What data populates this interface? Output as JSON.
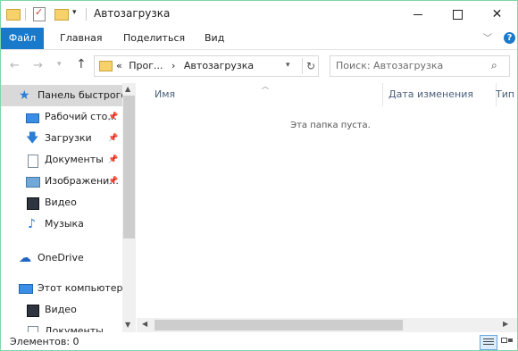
{
  "window": {
    "title": "Автозагрузка"
  },
  "ribbon": {
    "tabs": [
      "Файл",
      "Главная",
      "Поделиться",
      "Вид"
    ],
    "help": "?"
  },
  "address": {
    "prefix": "«",
    "segments": [
      "Прог...",
      "Автозагрузка"
    ]
  },
  "search": {
    "placeholder": "Поиск: Автозагрузка"
  },
  "nav_pane": {
    "items": [
      {
        "label": "Панель быстрого доступа",
        "icon": "star-icon",
        "pinned": false,
        "selected": true
      },
      {
        "label": "Рабочий сто...",
        "icon": "desktop-icon",
        "pinned": true
      },
      {
        "label": "Загрузки",
        "icon": "download-icon",
        "pinned": true
      },
      {
        "label": "Документы",
        "icon": "documents-icon",
        "pinned": true
      },
      {
        "label": "Изображени...",
        "icon": "pictures-icon",
        "pinned": true
      },
      {
        "label": "Видео",
        "icon": "video-icon",
        "pinned": false
      },
      {
        "label": "Музыка",
        "icon": "music-icon",
        "pinned": false
      },
      {
        "label": "OneDrive",
        "icon": "onedrive-icon",
        "pinned": false
      },
      {
        "label": "Этот компьютер",
        "icon": "computer-icon",
        "pinned": false
      },
      {
        "label": "Видео",
        "icon": "video-icon",
        "pinned": false
      },
      {
        "label": "Документы",
        "icon": "documents-icon",
        "pinned": false
      }
    ]
  },
  "columns": {
    "name": "Имя",
    "date": "Дата изменения",
    "type": "Тип"
  },
  "content": {
    "empty_message": "Эта папка пуста."
  },
  "status": {
    "items_count": "Элементов: 0"
  },
  "colors": {
    "accent": "#1979ca",
    "selected": "#d9d9d9",
    "frame": "#7ed6a8"
  }
}
